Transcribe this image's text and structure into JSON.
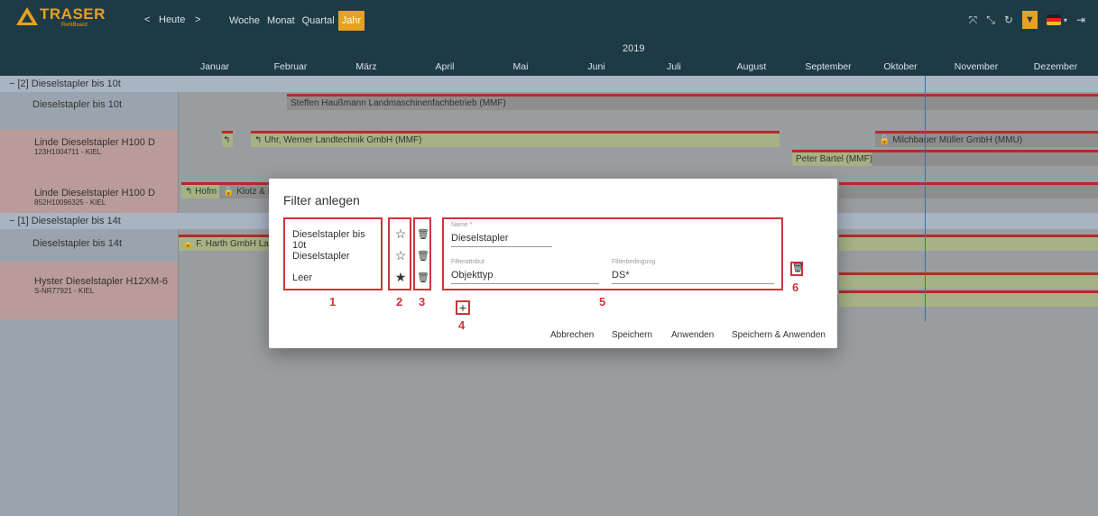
{
  "app": {
    "logo_name": "TRASER",
    "logo_sub": "RentBoard"
  },
  "nav": {
    "prev": "<",
    "today": "Heute",
    "next": ">"
  },
  "periods": [
    "Woche",
    "Monat",
    "Quartal",
    "Jahr"
  ],
  "active_period": "Jahr",
  "year": "2019",
  "months": [
    "Januar",
    "Februar",
    "März",
    "April",
    "Mai",
    "Juni",
    "Juli",
    "August",
    "September",
    "Oktober",
    "November",
    "Dezember"
  ],
  "groups": [
    {
      "label": "− [2] Dieselstapler bis 10t"
    },
    {
      "label": "− [1] Dieselstapler bis 14t"
    }
  ],
  "rows": [
    {
      "title": "Dieselstapler bis 10t",
      "sub": ""
    },
    {
      "title": "Linde Dieselstapler H100 D",
      "sub": "123H1004711 - KIEL"
    },
    {
      "title": "Linde Dieselstapler H100 D",
      "sub": "852H10096325 - KIEL"
    },
    {
      "title": "Dieselstapler bis 14t",
      "sub": ""
    },
    {
      "title": "Hyster Dieselstapler H12XM-6",
      "sub": "S-NR77921 - KIEL"
    }
  ],
  "bars": {
    "b1": "Steffen Haußmann Landmaschinenfachbetrieb (MMF)",
    "b2": "↰",
    "b3": "↰ Uhr, Werner Landtechnik GmbH (MMF)",
    "b4": "🔒 Milchbauer Müller GmbH (MMU)",
    "b5": "Peter Bartel (MMF)",
    "b6": "↰ Hofm",
    "b7": "🔒 Klotz & N",
    "b8": "🔒 F. Harth GmbH Lan"
  },
  "dialog": {
    "title": "Filter anlegen",
    "filters": [
      "Dieselstapler bis 10t",
      "Dieselstapler",
      "Leer"
    ],
    "stars": [
      "☆",
      "☆",
      "★"
    ],
    "name_label": "Name *",
    "name_value": "Dieselstapler",
    "attr_label": "Filterattribut",
    "attr_value": "Objekttyp",
    "cond_label": "Filterbedingung",
    "cond_value": "DS*",
    "add": "+",
    "buttons": [
      "Abbrechen",
      "Speichern",
      "Anwenden",
      "Speichern & Anwenden"
    ],
    "annotations": [
      "1",
      "2",
      "3",
      "4",
      "5",
      "6"
    ]
  },
  "colors": {
    "header": "#1e3b45",
    "accent": "#e8a020",
    "annotation": "#d0343a",
    "bar_green": "#a6b285"
  }
}
